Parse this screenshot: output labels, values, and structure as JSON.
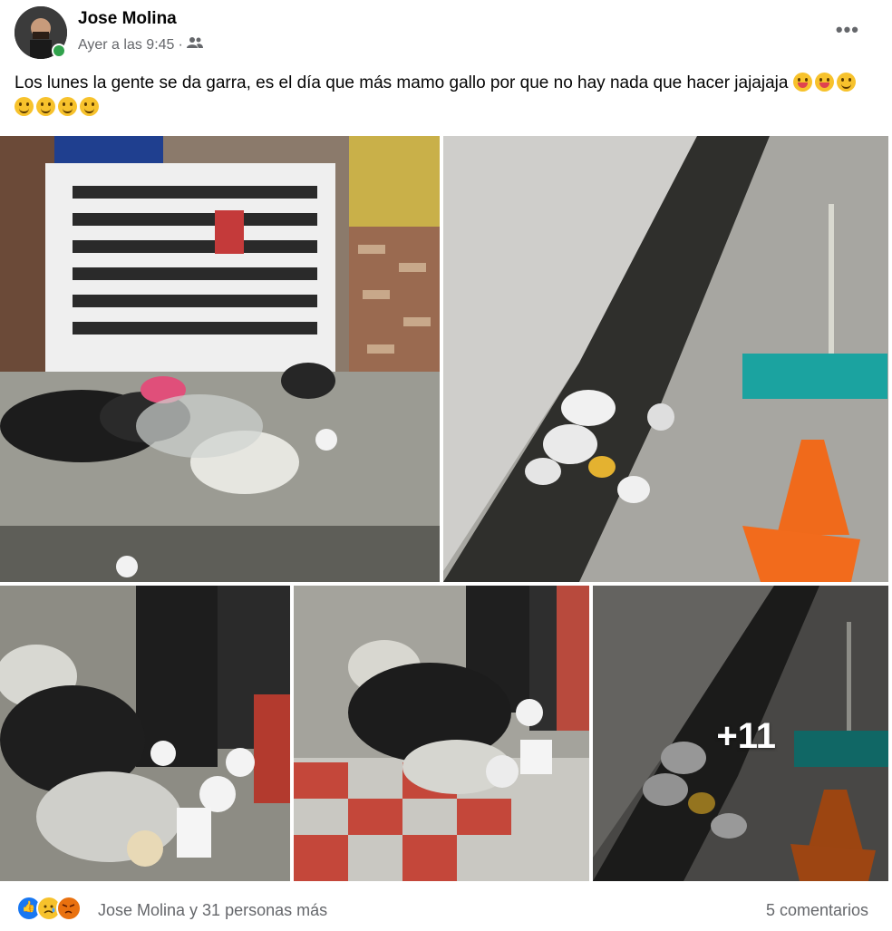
{
  "post": {
    "author": "Jose Molina",
    "timestamp": "Ayer a las 9:45",
    "separator": "·",
    "audience_icon": "friends-icon",
    "more_icon": "more-options-icon",
    "more_label": "•••",
    "text": "Los lunes la gente se da garra, es el día que más mamo gallo por que no hay nada que hacer jajajaja"
  },
  "gallery": {
    "extra_count": "+11"
  },
  "footer": {
    "reaction_icons": [
      "like-icon",
      "sad-icon",
      "angry-icon"
    ],
    "reactions_text": "Jose Molina y 31 personas más",
    "comments_text": "5 comentarios"
  },
  "colors": {
    "like": "#1877f2",
    "secondary_text": "#65676b",
    "online": "#31a24c"
  }
}
